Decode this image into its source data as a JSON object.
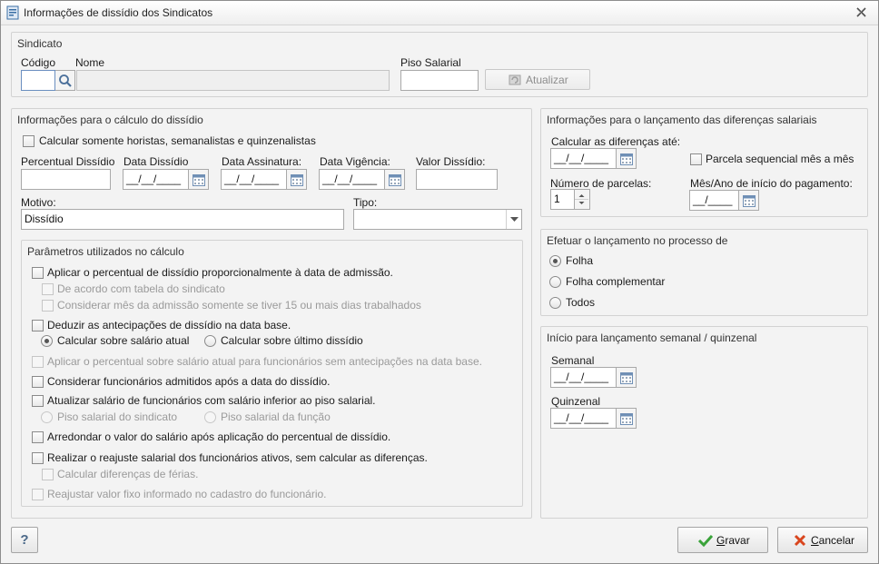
{
  "window": {
    "title": "Informações de dissídio dos Sindicatos"
  },
  "sindicato": {
    "group_title": "Sindicato",
    "codigo_label": "Código",
    "nome_label": "Nome",
    "piso_label": "Piso Salarial",
    "atualizar_label": "Atualizar",
    "codigo_value": "",
    "nome_value": "",
    "piso_value": ""
  },
  "calculo": {
    "group_title": "Informações para o cálculo do dissídio",
    "somente_horistas_label": "Calcular somente horistas, semanalistas e quinzenalistas",
    "percentual_label": "Percentual Dissídio",
    "data_dissidio_label": "Data Dissídio",
    "data_assinatura_label": "Data Assinatura:",
    "data_vigencia_label": "Data Vigência:",
    "valor_dissidio_label": "Valor Dissídio:",
    "date_mask": "__/__/____",
    "motivo_label": "Motivo:",
    "motivo_value": "Dissídio",
    "tipo_label": "Tipo:",
    "tipo_value": ""
  },
  "parametros": {
    "group_title": "Parâmetros utilizados no cálculo",
    "aplicar_proporcional": "Aplicar o percentual de dissídio proporcionalmente à data de admissão.",
    "de_acordo_tabela": "De acordo com tabela do sindicato",
    "considerar_mes_admissao": "Considerar mês da admissão somente se tiver 15 ou mais dias trabalhados",
    "deduzir_antecipacoes": "Deduzir as antecipações de dissídio na data base.",
    "calcular_salario_atual": "Calcular sobre salário atual",
    "calcular_ultimo_dissidio": "Calcular sobre último dissídio",
    "aplicar_sem_antecipacoes": "Aplicar o percentual sobre salário atual para funcionários sem antecipações na data base.",
    "considerar_admitidos": "Considerar funcionários admitidos após a data do dissídio.",
    "atualizar_salario_inferior": "Atualizar salário de funcionários com salário inferior ao piso salarial.",
    "piso_sindicato": "Piso salarial do sindicato",
    "piso_funcao": "Piso salarial da função",
    "arredondar": "Arredondar o valor do salário após aplicação do percentual de dissídio.",
    "realizar_reajuste": "Realizar o reajuste salarial dos funcionários ativos, sem calcular as diferenças.",
    "calcular_ferias": "Calcular diferenças de férias.",
    "reajustar_valor_fixo": "Reajustar valor fixo informado no cadastro do funcionário."
  },
  "lancamento": {
    "group_title": "Informações para o lançamento das diferenças salariais",
    "calcular_ate_label": "Calcular as diferenças até:",
    "calcular_ate_value": "__/__/____",
    "parcela_sequencial_label": "Parcela sequencial mês a mês",
    "num_parcelas_label": "Número de parcelas:",
    "num_parcelas_value": "1",
    "mes_ano_label": "Mês/Ano de início do pagamento:",
    "mes_ano_value": "__/____"
  },
  "processo": {
    "group_title": "Efetuar o lançamento no processo de",
    "options": [
      "Folha",
      "Folha complementar",
      "Todos"
    ]
  },
  "semanal": {
    "group_title": "Início para lançamento semanal / quinzenal",
    "semanal_label": "Semanal",
    "semanal_value": "__/__/____",
    "quinzenal_label": "Quinzenal",
    "quinzenal_value": "__/__/____"
  },
  "footer": {
    "help_label": "?",
    "gravar_mnemonic": "G",
    "gravar_rest": "ravar",
    "cancelar_mnemonic": "C",
    "cancelar_rest": "ancelar"
  },
  "colors": {
    "gravar_check": "#3aa33a",
    "cancelar_x": "#d9461e"
  }
}
